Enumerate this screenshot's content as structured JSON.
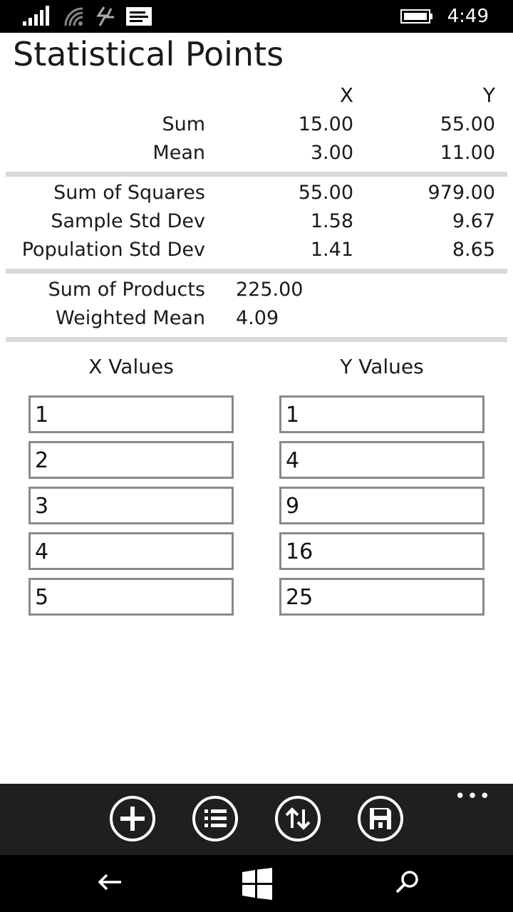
{
  "status": {
    "time": "4:49",
    "icons": [
      "signal-icon",
      "wifi-icon",
      "data-icon",
      "message-icon",
      "battery-icon"
    ]
  },
  "page": {
    "title": "Statistical Points"
  },
  "columns": {
    "x": "X",
    "y": "Y"
  },
  "stats": {
    "sum": {
      "label": "Sum",
      "x": "15.00",
      "y": "55.00"
    },
    "mean": {
      "label": "Mean",
      "x": "3.00",
      "y": "11.00"
    },
    "sum_sq": {
      "label": "Sum of Squares",
      "x": "55.00",
      "y": "979.00"
    },
    "sample_sd": {
      "label": "Sample Std Dev",
      "x": "1.58",
      "y": "9.67"
    },
    "pop_sd": {
      "label": "Population Std Dev",
      "x": "1.41",
      "y": "8.65"
    },
    "sum_prod": {
      "label": "Sum of Products",
      "value": "225.00"
    },
    "weighted_mean": {
      "label": "Weighted Mean",
      "value": "4.09"
    }
  },
  "values": {
    "x_header": "X Values",
    "y_header": "Y Values",
    "x": [
      "1",
      "2",
      "3",
      "4",
      "5"
    ],
    "y": [
      "1",
      "4",
      "9",
      "16",
      "25"
    ]
  },
  "app_bar": {
    "buttons": [
      "add-icon",
      "list-icon",
      "sort-icon",
      "save-icon"
    ],
    "more": "•••"
  },
  "nav": {
    "buttons": [
      "back-icon",
      "windows-icon",
      "search-icon"
    ]
  },
  "colors": {
    "status_bg": "#000000",
    "app_bar_bg": "#1f1f1f",
    "divider": "#d9d9d9",
    "box_border": "#8a8a8a"
  }
}
